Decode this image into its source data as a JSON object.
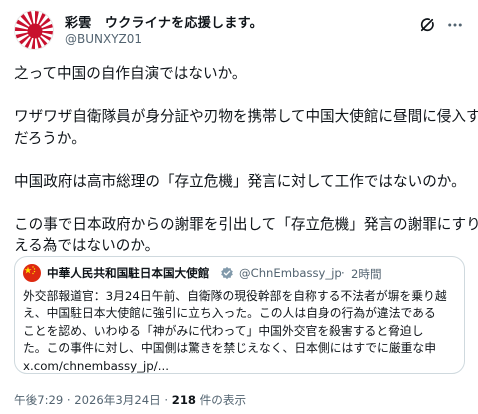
{
  "author": {
    "display_name": "彩雲　ウクライナを応援します。",
    "handle": "@BUNXYZ01",
    "avatar_icon": "rising-sun-flag-icon"
  },
  "actions": {
    "grok_icon": "grok-icon",
    "more_icon": "more-icon"
  },
  "post": {
    "lines": [
      "之って中国の自作自演ではないか。",
      "",
      "ワザワザ自衛隊員が身分証や刃物を携帯して中国大使館に昼間に侵入する",
      "だろうか。",
      "",
      "中国政府は高市総理の「存立危機」発言に対して工作ではないのか。",
      "",
      "この事で日本政府からの謝罪を引出して「存立危機」発言の謝罪にすり替",
      "える為ではないのか。"
    ]
  },
  "quote": {
    "display_name": "中華人民共和国駐日本国大使館",
    "verified_icon": "government-verified-badge-icon",
    "handle": "@ChnEmbassy_jp",
    "separator": "·",
    "time": "2時間",
    "lines": [
      "外交部報道官：3月24日午前、自衛隊の現役幹部を自称する不法者が塀を乗り越",
      "え、中国駐日本大使館に強引に立ち入った。この人は自身の行為が違法である",
      "ことを認め、いわゆる「神がみに代わって」中国外交官を殺害すると脅迫し",
      "た。この事件に対し、中国側は驚きを禁じえなく、日本側にはすでに厳重な申",
      "x.com/chnembassy_jp/..."
    ]
  },
  "meta": {
    "time": "午後7:29",
    "sep1": " · ",
    "date": "2026年3月24日",
    "sep2": " · ",
    "views": "218",
    "views_label": " 件の表示"
  },
  "colors": {
    "flag_red": "#c8102e",
    "text_primary": "#0f1419",
    "text_secondary": "#536471",
    "border": "#cfd9de",
    "badge_gray": "#829aab"
  }
}
